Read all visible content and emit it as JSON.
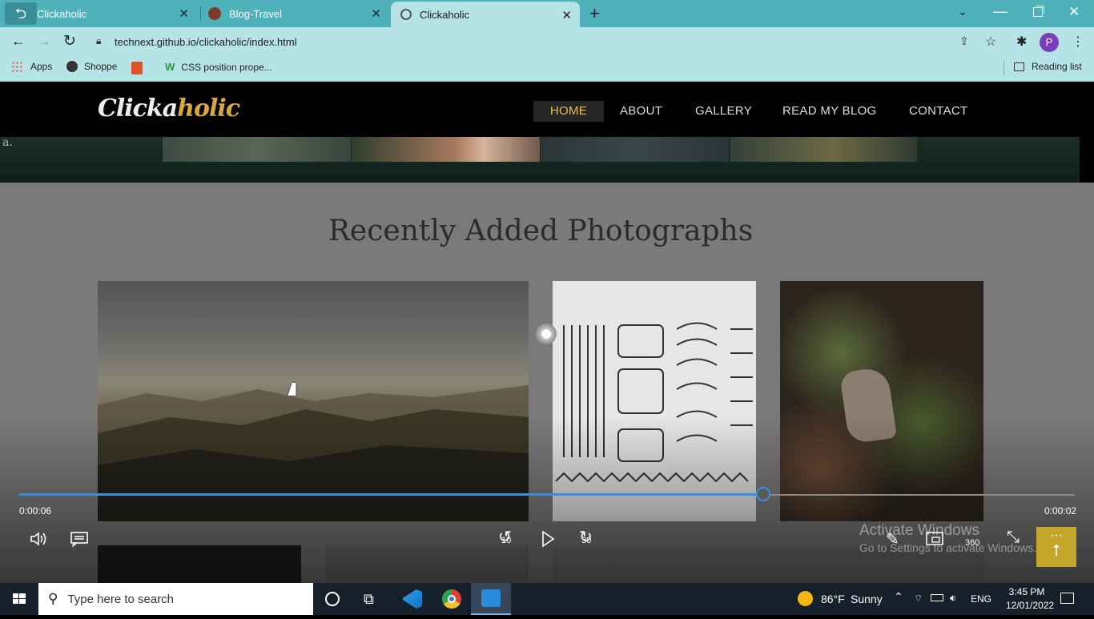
{
  "browser": {
    "tabs": [
      {
        "label": "Clickaholic",
        "active": false
      },
      {
        "label": "Blog-Travel",
        "active": false
      },
      {
        "label": "Clickaholic",
        "active": true
      }
    ],
    "url": "technext.github.io/clickaholic/index.html",
    "bookmarks": [
      "Apps",
      "Shoppe",
      "CSS position prope..."
    ],
    "reading_list": "Reading list",
    "profile_initial": "P"
  },
  "site": {
    "logo_a": "Clicka",
    "logo_b": "holic",
    "nav": [
      "HOME",
      "ABOUT",
      "GALLERY",
      "READ MY BLOG",
      "CONTACT"
    ],
    "banner_fragment": "a.",
    "section_title": "Recently Added Photographs"
  },
  "video": {
    "progress": 0.705,
    "elapsed": "0:00:06",
    "remaining": "0:00:02",
    "skip_back": "10",
    "skip_forward": "30",
    "mode_360": "360"
  },
  "watermark": {
    "line1": "Activate Windows",
    "line2": "Go to Settings to activate Windows."
  },
  "taskbar": {
    "search_placeholder": "Type here to search",
    "weather_temp": "86°F",
    "weather_desc": "Sunny",
    "language": "ENG",
    "time": "3:45 PM",
    "date": "12/01/2022"
  },
  "colors": {
    "tabstrip": "#4fb2bb",
    "toolbar": "#b6e3e6",
    "nav_active": "#e8c04a",
    "seek": "#3b8fd8"
  }
}
